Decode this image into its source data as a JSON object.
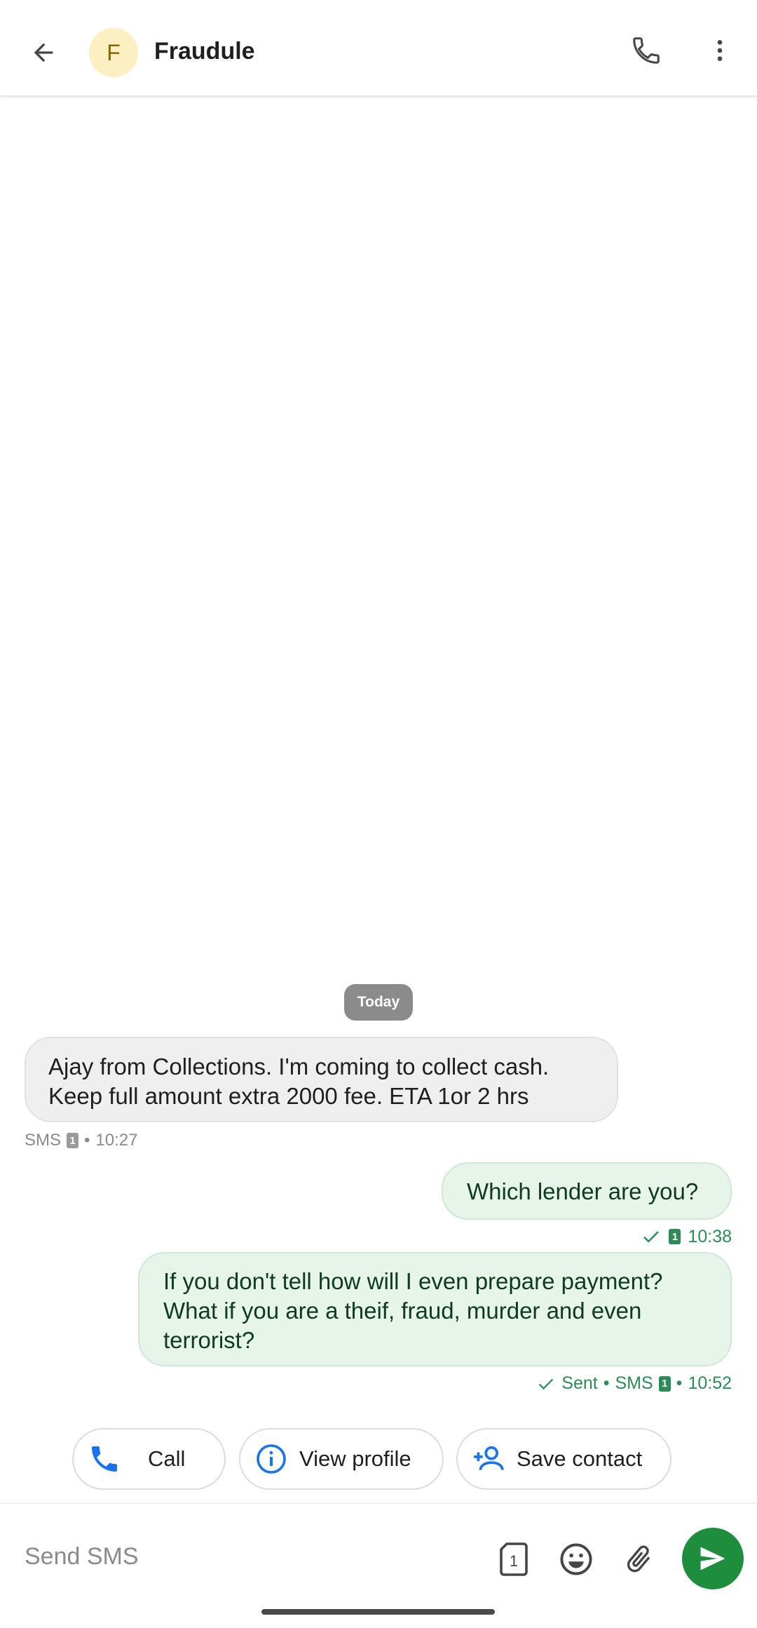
{
  "header": {
    "avatar_letter": "F",
    "contact_name": "Fraudule",
    "back_icon": "arrow-back-icon",
    "call_icon": "phone-icon",
    "more_icon": "more-vert-icon"
  },
  "conversation": {
    "date_chip": "Today",
    "messages": [
      {
        "direction": "incoming",
        "lines": [
          "Ajay from Collections. I'm coming to collect cash.",
          "Keep full amount extra 2000 fee. ETA 1or 2 hrs"
        ],
        "meta": {
          "type": "SMS",
          "sim": "1",
          "separator": "•",
          "time": "10:27"
        }
      },
      {
        "direction": "outgoing",
        "lines": [
          "Which lender are you?"
        ],
        "meta": {
          "sim": "1",
          "time": "10:38"
        }
      },
      {
        "direction": "outgoing",
        "lines": [
          "If you don't tell how will I even prepare payment?",
          "What if you are a theif, fraud, murder and even",
          "terrorist?"
        ],
        "meta": {
          "status": "Sent",
          "type": "SMS",
          "sim": "1",
          "separator": "•",
          "time": "10:52"
        }
      }
    ]
  },
  "suggestions": [
    {
      "label": "Call",
      "icon": "phone-icon"
    },
    {
      "label": "View profile",
      "icon": "info-icon"
    },
    {
      "label": "Save contact",
      "icon": "person-add-icon"
    }
  ],
  "composer": {
    "placeholder": "Send SMS",
    "sim_icon_label": "1",
    "emoji_icon": "emoji-icon",
    "attach_icon": "attach-icon",
    "send_icon": "send-icon"
  },
  "colors": {
    "accent_green": "#1e8e3e",
    "outgoing_bubble": "#e6f4ea",
    "incoming_bubble": "#efefef",
    "link_blue": "#1a73e8"
  }
}
